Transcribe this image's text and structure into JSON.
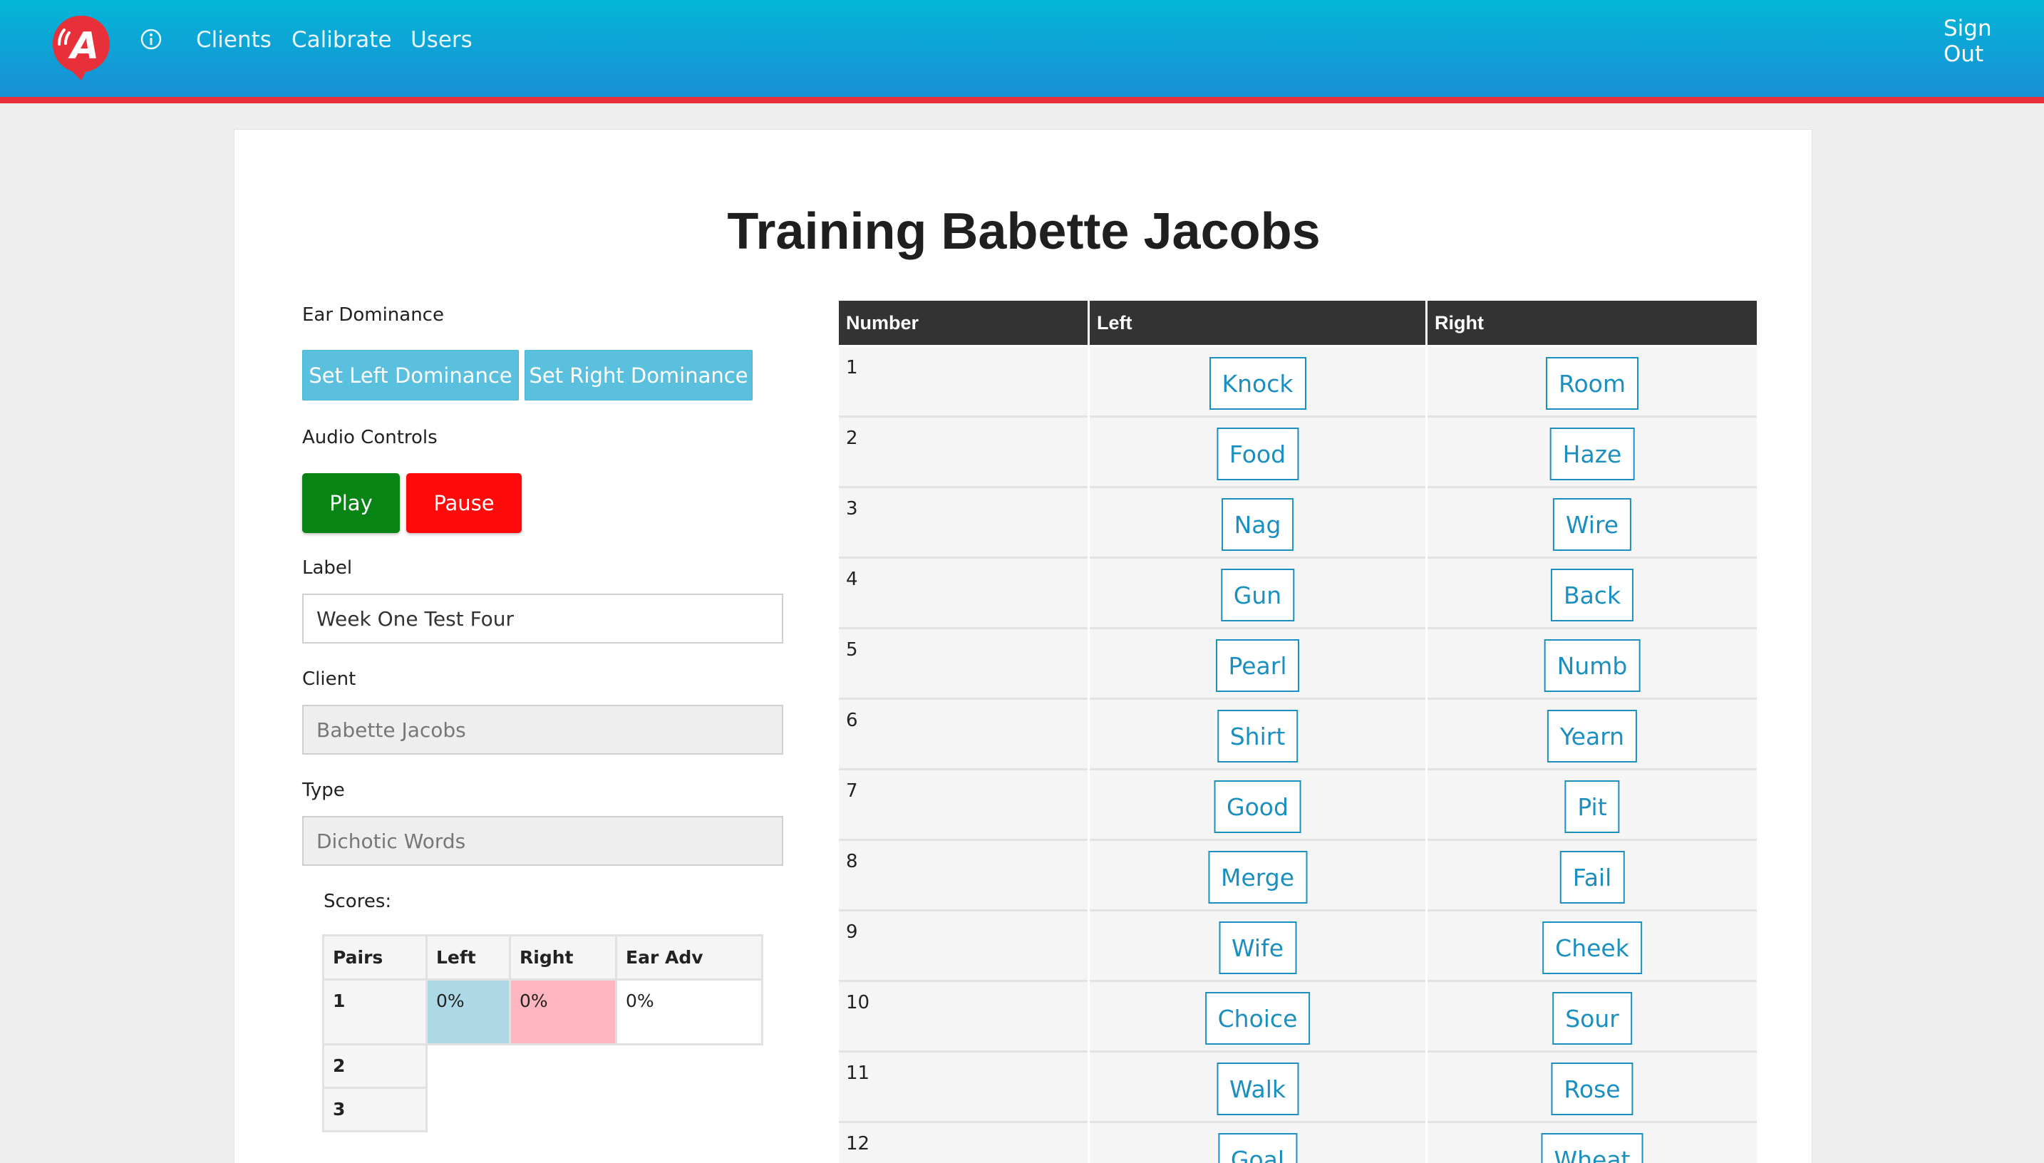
{
  "nav": {
    "links": [
      "Clients",
      "Calibrate",
      "Users"
    ],
    "sign_out_line1": "Sign",
    "sign_out_line2": "Out",
    "logo_letter": "A",
    "info_icon": "info-circle-icon",
    "brand_color": "#e8303a"
  },
  "page": {
    "title": "Training Babette Jacobs"
  },
  "ear_dominance": {
    "label": "Ear Dominance",
    "set_left": "Set Left Dominance",
    "set_right": "Set Right Dominance"
  },
  "audio": {
    "label": "Audio Controls",
    "play": "Play",
    "pause": "Pause",
    "play_color": "#078413",
    "pause_color": "#fe0a0a"
  },
  "form": {
    "label_caption": "Label",
    "label_value": "Week One Test Four",
    "client_caption": "Client",
    "client_value": "Babette Jacobs",
    "type_caption": "Type",
    "type_value": "Dichotic Words"
  },
  "scores": {
    "caption": "Scores:",
    "headers": [
      "Pairs",
      "Left",
      "Right",
      "Ear Adv"
    ],
    "rows": [
      {
        "pair": "1",
        "left": "0%",
        "right": "0%",
        "ear_adv": "0%"
      },
      {
        "pair": "2"
      },
      {
        "pair": "3"
      }
    ],
    "left_color": "#add8e6",
    "right_color": "#ffb6c1"
  },
  "words_table": {
    "headers": [
      "Number",
      "Left",
      "Right"
    ],
    "rows": [
      {
        "number": "1",
        "left": "Knock",
        "right": "Room"
      },
      {
        "number": "2",
        "left": "Food",
        "right": "Haze"
      },
      {
        "number": "3",
        "left": "Nag",
        "right": "Wire"
      },
      {
        "number": "4",
        "left": "Gun",
        "right": "Back"
      },
      {
        "number": "5",
        "left": "Pearl",
        "right": "Numb"
      },
      {
        "number": "6",
        "left": "Shirt",
        "right": "Yearn"
      },
      {
        "number": "7",
        "left": "Good",
        "right": "Pit"
      },
      {
        "number": "8",
        "left": "Merge",
        "right": "Fail"
      },
      {
        "number": "9",
        "left": "Wife",
        "right": "Cheek"
      },
      {
        "number": "10",
        "left": "Choice",
        "right": "Sour"
      },
      {
        "number": "11",
        "left": "Walk",
        "right": "Rose"
      },
      {
        "number": "12",
        "left": "Goal",
        "right": "Wheat"
      }
    ]
  }
}
